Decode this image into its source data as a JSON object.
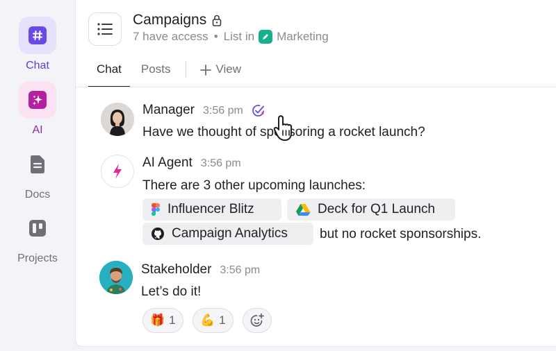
{
  "sidebar": {
    "items": [
      {
        "label": "Chat",
        "icon": "hashtag-icon",
        "active": true
      },
      {
        "label": "AI",
        "icon": "sparkle-icon"
      },
      {
        "label": "Docs",
        "icon": "document-icon"
      },
      {
        "label": "Projects",
        "icon": "board-icon"
      }
    ]
  },
  "header": {
    "title": "Campaigns",
    "access": "7 have access",
    "separator": "•",
    "list_in": "List in",
    "space_name": "Marketing"
  },
  "tabs": {
    "chat": "Chat",
    "posts": "Posts",
    "view": "View",
    "active": "Chat"
  },
  "messages": [
    {
      "author": "Manager",
      "time": "3:56 pm",
      "text": "Have we thought of sponsoring a rocket launch?"
    },
    {
      "author": "AI Agent",
      "time": "3:56 pm",
      "text": "There are 3 other upcoming launches:",
      "chips": [
        {
          "label": "Influencer Blitz",
          "icon": "figma-icon"
        },
        {
          "label": "Deck for Q1 Launch",
          "icon": "google-drive-icon"
        },
        {
          "label": "Campaign Analytics",
          "icon": "github-icon"
        }
      ],
      "suffix": "but no rocket sponsorships."
    },
    {
      "author": "Stakeholder",
      "time": "3:56 pm",
      "text": "Let’s do it!",
      "reactions": [
        {
          "emoji": "🎁",
          "count": "1"
        },
        {
          "emoji": "💪",
          "count": "1"
        }
      ]
    }
  ],
  "colors": {
    "accent_purple": "#5a3fd6",
    "ai_pink": "#e0259a",
    "space_green": "#16b08c"
  }
}
